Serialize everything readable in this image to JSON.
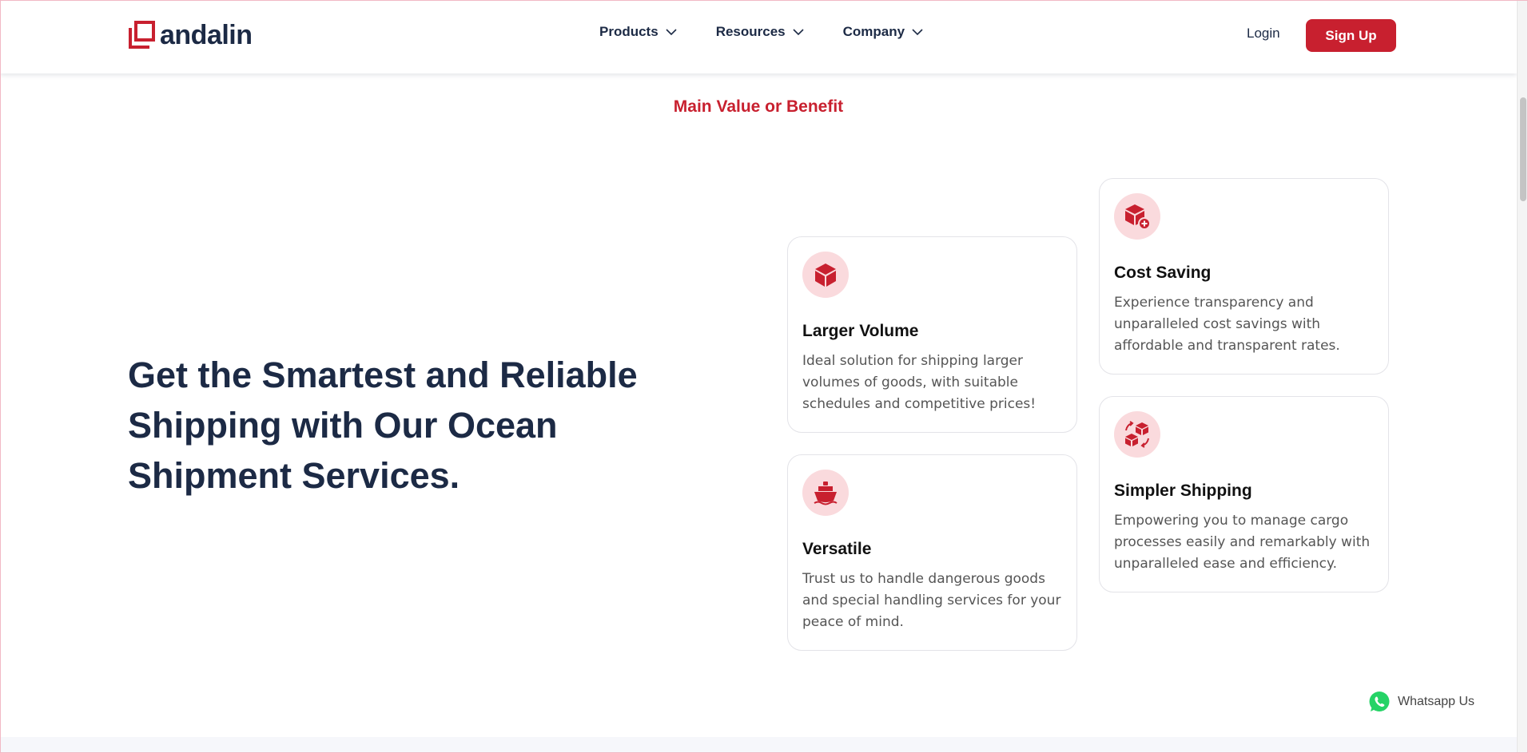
{
  "brand": {
    "name": "andalin",
    "accent": "#c8202f",
    "navy": "#1c2a45"
  },
  "nav": {
    "items": [
      {
        "label": "Products"
      },
      {
        "label": "Resources"
      },
      {
        "label": "Company"
      }
    ],
    "login": "Login",
    "signup": "Sign Up"
  },
  "section": {
    "eyebrow": "Main Value or Benefit",
    "headline": "Get the Smartest and Reliable Shipping with Our Ocean Shipment Services."
  },
  "cards": [
    {
      "icon": "box-icon",
      "title": "Larger Volume",
      "desc": "Ideal solution for shipping larger volumes of goods, with suitable schedules and competitive prices!"
    },
    {
      "icon": "box-plus-icon",
      "title": "Cost Saving",
      "desc": "Experience transparency and unparalleled cost savings with affordable and transparent rates."
    },
    {
      "icon": "ship-icon",
      "title": "Versatile",
      "desc": "Trust us to handle dangerous goods and special handling services for your peace of mind."
    },
    {
      "icon": "boxes-cycle-icon",
      "title": "Simpler Shipping",
      "desc": "Empowering you to manage cargo processes easily and remarkably with unparalleled ease and efficiency."
    }
  ],
  "whatsapp": {
    "label": "Whatsapp Us",
    "icon": "whatsapp-icon",
    "color": "#25d366"
  }
}
